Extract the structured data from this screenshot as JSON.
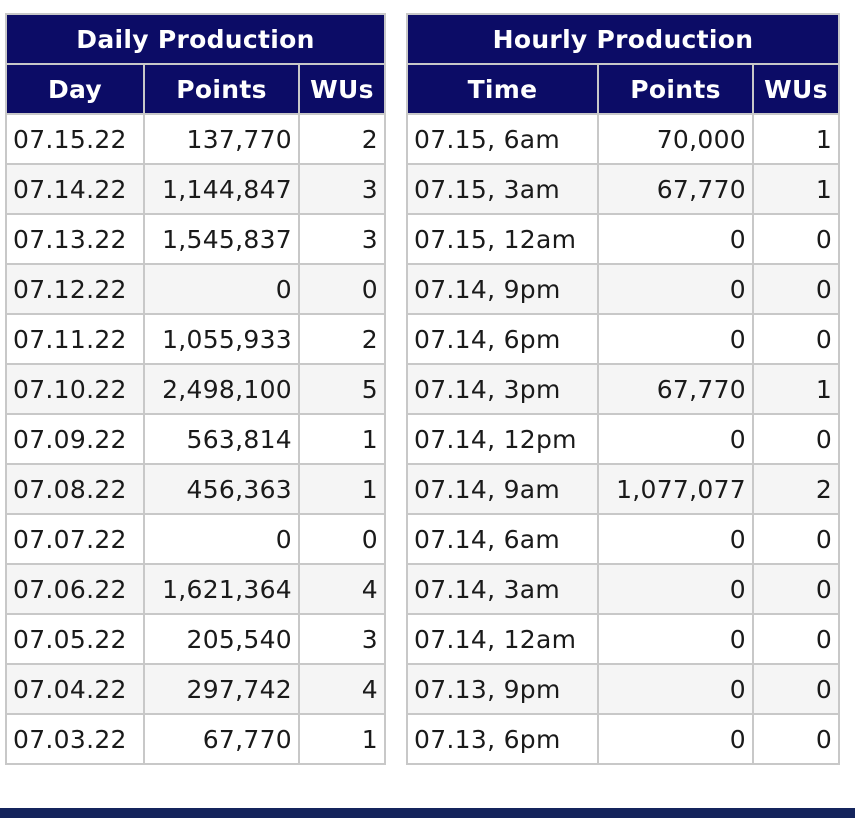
{
  "daily": {
    "title": "Daily Production",
    "headers": [
      "Day",
      "Points",
      "WUs"
    ],
    "rows": [
      [
        "07.15.22",
        "137,770",
        "2"
      ],
      [
        "07.14.22",
        "1,144,847",
        "3"
      ],
      [
        "07.13.22",
        "1,545,837",
        "3"
      ],
      [
        "07.12.22",
        "0",
        "0"
      ],
      [
        "07.11.22",
        "1,055,933",
        "2"
      ],
      [
        "07.10.22",
        "2,498,100",
        "5"
      ],
      [
        "07.09.22",
        "563,814",
        "1"
      ],
      [
        "07.08.22",
        "456,363",
        "1"
      ],
      [
        "07.07.22",
        "0",
        "0"
      ],
      [
        "07.06.22",
        "1,621,364",
        "4"
      ],
      [
        "07.05.22",
        "205,540",
        "3"
      ],
      [
        "07.04.22",
        "297,742",
        "4"
      ],
      [
        "07.03.22",
        "67,770",
        "1"
      ]
    ]
  },
  "hourly": {
    "title": "Hourly Production",
    "headers": [
      "Time",
      "Points",
      "WUs"
    ],
    "rows": [
      [
        "07.15, 6am",
        "70,000",
        "1"
      ],
      [
        "07.15, 3am",
        "67,770",
        "1"
      ],
      [
        "07.15, 12am",
        "0",
        "0"
      ],
      [
        "07.14, 9pm",
        "0",
        "0"
      ],
      [
        "07.14, 6pm",
        "0",
        "0"
      ],
      [
        "07.14, 3pm",
        "67,770",
        "1"
      ],
      [
        "07.14, 12pm",
        "0",
        "0"
      ],
      [
        "07.14, 9am",
        "1,077,077",
        "2"
      ],
      [
        "07.14, 6am",
        "0",
        "0"
      ],
      [
        "07.14, 3am",
        "0",
        "0"
      ],
      [
        "07.14, 12am",
        "0",
        "0"
      ],
      [
        "07.13, 9pm",
        "0",
        "0"
      ],
      [
        "07.13, 6pm",
        "0",
        "0"
      ]
    ]
  },
  "colors": {
    "header_bg": "#0c0c66",
    "header_text": "#ffffff",
    "row_alt_bg": "#f5f5f5",
    "border": "#c8c8c8",
    "footer_bar": "#14245c"
  }
}
